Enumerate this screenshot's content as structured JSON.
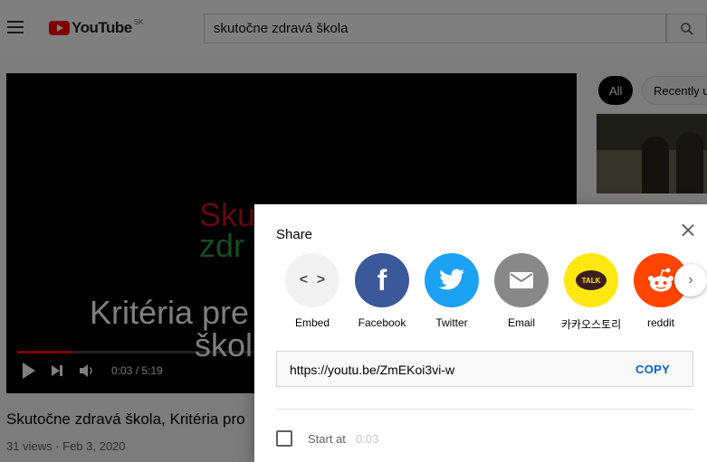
{
  "header": {
    "logo_word": "YouTube",
    "logo_country": "SK",
    "search_value": "skutočne zdravá škola"
  },
  "player": {
    "title_line1": "Sku",
    "title_line2": "zdr",
    "subtitle_line1": "Kritéria pre",
    "subtitle_line2": "škol",
    "time": "0:03 / 5:19",
    "progress": 0.1,
    "title_colors": {
      "line1": "#c8141f",
      "line2": "#2f9a3c"
    }
  },
  "video": {
    "title": "Skutočne zdravá škola, Kritéria pro",
    "meta": "31 views · Feb 3, 2020"
  },
  "sidebar": {
    "chips": [
      "All",
      "Recently u"
    ]
  },
  "share": {
    "title": "Share",
    "targets": [
      {
        "label": "Embed",
        "icon": "embed-icon",
        "color": "#f2f2f2"
      },
      {
        "label": "Facebook",
        "icon": "facebook-icon",
        "color": "#3b5998"
      },
      {
        "label": "Twitter",
        "icon": "twitter-icon",
        "color": "#1da1f2"
      },
      {
        "label": "Email",
        "icon": "email-icon",
        "color": "#888888"
      },
      {
        "label": "카카오스토리",
        "icon": "kakaostory-icon",
        "color": "#ffe812"
      },
      {
        "label": "reddit",
        "icon": "reddit-icon",
        "color": "#ff4500"
      }
    ],
    "kakao_badge": "TALK",
    "facebook_glyph": "f",
    "url": "https://youtu.be/ZmEKoi3vi-w",
    "copy_label": "COPY",
    "start_at_label": "Start at",
    "start_at_time": "0:03",
    "start_at_checked": false
  }
}
